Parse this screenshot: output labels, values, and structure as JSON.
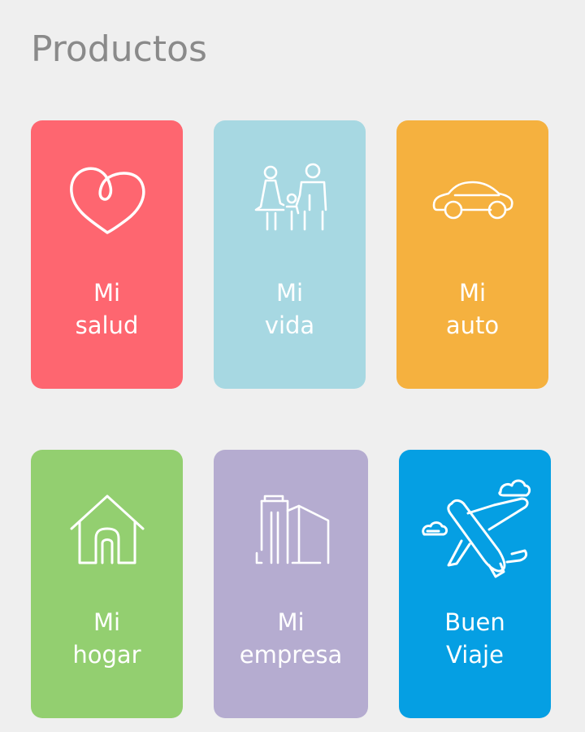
{
  "header": {
    "title": "Productos"
  },
  "products": [
    {
      "line1": "Mi",
      "line2": "salud",
      "icon": "heart-icon",
      "color": "#fe6670"
    },
    {
      "line1": "Mi",
      "line2": "vida",
      "icon": "family-icon",
      "color": "#a7d8e2"
    },
    {
      "line1": "Mi",
      "line2": "auto",
      "icon": "car-icon",
      "color": "#f5b13f"
    },
    {
      "line1": "Mi",
      "line2": "hogar",
      "icon": "house-icon",
      "color": "#93cf70"
    },
    {
      "line1": "Mi",
      "line2": "empresa",
      "icon": "buildings-icon",
      "color": "#b5acd0"
    },
    {
      "line1": "Buen",
      "line2": "Viaje",
      "icon": "airplane-icon",
      "color": "#059fe3"
    }
  ]
}
